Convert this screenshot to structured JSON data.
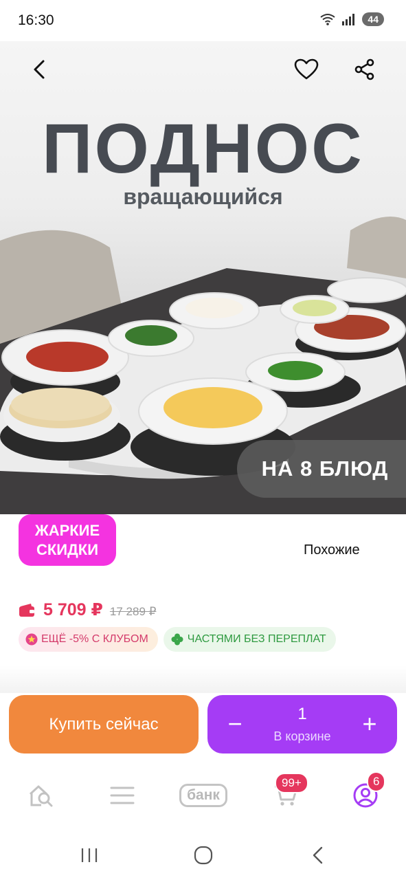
{
  "status_bar": {
    "time": "16:30",
    "battery": "44"
  },
  "hero": {
    "title": "ПОДНОС",
    "subtitle": "вращающийся",
    "badge": "НА 8 БЛЮД"
  },
  "promo": {
    "hot_deals_line1": "ЖАРКИЕ",
    "hot_deals_line2": "СКИДКИ",
    "similar": "Похожие"
  },
  "price": {
    "current": "5 709 ₽",
    "old": "17 289 ₽"
  },
  "chips": {
    "club": "ЕЩЁ -5% С КЛУБОМ",
    "installments": "ЧАСТЯМИ БЕЗ ПЕРЕПЛАТ"
  },
  "actions": {
    "buy_now": "Купить сейчас",
    "cart_qty": "1",
    "cart_label": "В корзине",
    "minus": "−",
    "plus": "+"
  },
  "tabbar": {
    "bank": "банк",
    "cart_badge": "99+",
    "profile_badge": "6"
  },
  "colors": {
    "accent_pink": "#f433e0",
    "price_red": "#e5365d",
    "buy_orange": "#f1883d",
    "cart_purple": "#a53cf5"
  }
}
